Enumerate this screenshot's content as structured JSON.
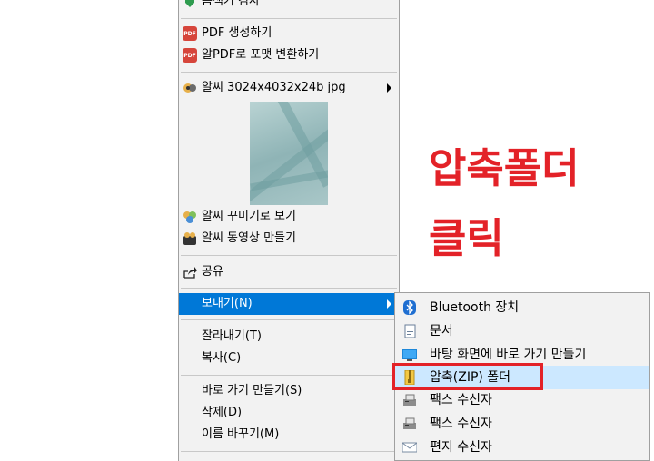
{
  "context_menu": {
    "items": [
      {
        "label": "음색기 검사"
      },
      {
        "label": "PDF 생성하기"
      },
      {
        "label": "알PDF로 포맷 변환하기"
      },
      {
        "label": "알씨 3024x4032x24b jpg"
      },
      {
        "label": "알씨 꾸미기로 보기"
      },
      {
        "label": "알씨 동영상 만들기"
      },
      {
        "label": "공유"
      },
      {
        "label": "보내기(N)"
      },
      {
        "label": "잘라내기(T)"
      },
      {
        "label": "복사(C)"
      },
      {
        "label": "바로 가기 만들기(S)"
      },
      {
        "label": "삭제(D)"
      },
      {
        "label": "이름 바꾸기(M)"
      }
    ],
    "pdf_icon_text": "PDF"
  },
  "send_to_submenu": {
    "items": [
      {
        "label": "Bluetooth 장치",
        "icon": "bluetooth-icon"
      },
      {
        "label": "문서",
        "icon": "documents-icon"
      },
      {
        "label": "바탕 화면에 바로 가기 만들기",
        "icon": "desktop-icon"
      },
      {
        "label": "압축(ZIP) 폴더",
        "icon": "zip-folder-icon"
      },
      {
        "label": "팩스 수신자",
        "icon": "fax-icon"
      },
      {
        "label": "팩스 수신자",
        "icon": "fax-icon"
      },
      {
        "label": "편지 수신자",
        "icon": "mail-icon"
      }
    ]
  },
  "annotation": {
    "line1": "압축폴더",
    "line2": "클릭",
    "color": "#e32228"
  },
  "colors": {
    "highlight": "#0078d7",
    "hover": "#cce8ff"
  }
}
